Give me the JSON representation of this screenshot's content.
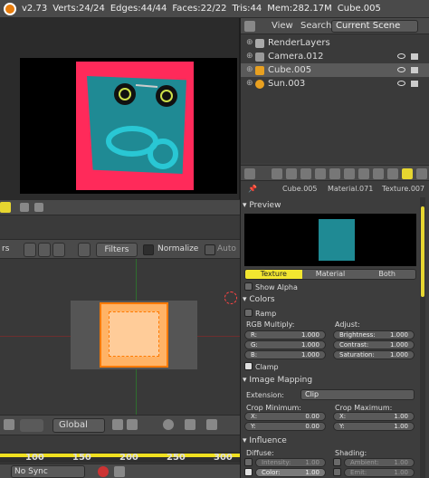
{
  "header": {
    "version": "v2.73",
    "verts": "Verts:24/24",
    "edges": "Edges:44/44",
    "faces": "Faces:22/22",
    "tris": "Tris:44",
    "mem": "Mem:282.17M",
    "object": "Cube.005"
  },
  "node_header": {
    "label_partial": "rs",
    "filters": "Filters",
    "normalize": "Normalize",
    "auto": "Auto"
  },
  "tex_toolbar": {
    "pivot": "Global"
  },
  "timeline": {
    "ticks": [
      "100",
      "150",
      "200",
      "250",
      "300"
    ]
  },
  "timebar": {
    "sync": "No Sync"
  },
  "outliner": {
    "menu_view": "View",
    "menu_search": "Search",
    "scene_selector": "Current Scene",
    "rows": [
      {
        "name": "RenderLayers",
        "icon": "render-layers-icon",
        "color": "#aaaaaa"
      },
      {
        "name": "Camera.012",
        "icon": "camera-icon",
        "color": "#999999"
      },
      {
        "name": "Cube.005",
        "icon": "cube-icon",
        "color": "#e8a020"
      },
      {
        "name": "Sun.003",
        "icon": "lamp-icon",
        "color": "#e8a020"
      }
    ]
  },
  "props": {
    "path": {
      "obj": "Cube.005",
      "mat": "Material.071",
      "tex": "Texture.007"
    },
    "preview_title": "Preview",
    "preview_tabs": [
      "Texture",
      "Material",
      "Both"
    ],
    "show_alpha": "Show Alpha",
    "colors_title": "Colors",
    "ramp": "Ramp",
    "rgb_label": "RGB Multiply:",
    "adjust_label": "Adjust:",
    "rgb": [
      {
        "k": "R:",
        "v": "1.000"
      },
      {
        "k": "G:",
        "v": "1.000"
      },
      {
        "k": "B:",
        "v": "1.000"
      }
    ],
    "adjust": [
      {
        "k": "Brightness:",
        "v": "1.000"
      },
      {
        "k": "Contrast:",
        "v": "1.000"
      },
      {
        "k": "Saturation:",
        "v": "1.000"
      }
    ],
    "clamp": "Clamp",
    "mapping_title": "Image Mapping",
    "extension_label": "Extension:",
    "extension_value": "Clip",
    "crop_min": "Crop Minimum:",
    "crop_max": "Crop Maximum:",
    "crop_min_vals": [
      {
        "k": "X:",
        "v": "0.00"
      },
      {
        "k": "Y:",
        "v": "0.00"
      }
    ],
    "crop_max_vals": [
      {
        "k": "X:",
        "v": "1.00"
      },
      {
        "k": "Y:",
        "v": "1.00"
      }
    ],
    "influence_title": "Influence",
    "diffuse": "Diffuse:",
    "shading": "Shading:",
    "intensity": {
      "k": "Intensity:",
      "v": "1.00"
    },
    "ambient": {
      "k": "Ambient:",
      "v": "1.00"
    },
    "color": {
      "k": "Color:",
      "v": "1.00"
    },
    "emit": {
      "k": "Emit:",
      "v": "1.00"
    }
  }
}
